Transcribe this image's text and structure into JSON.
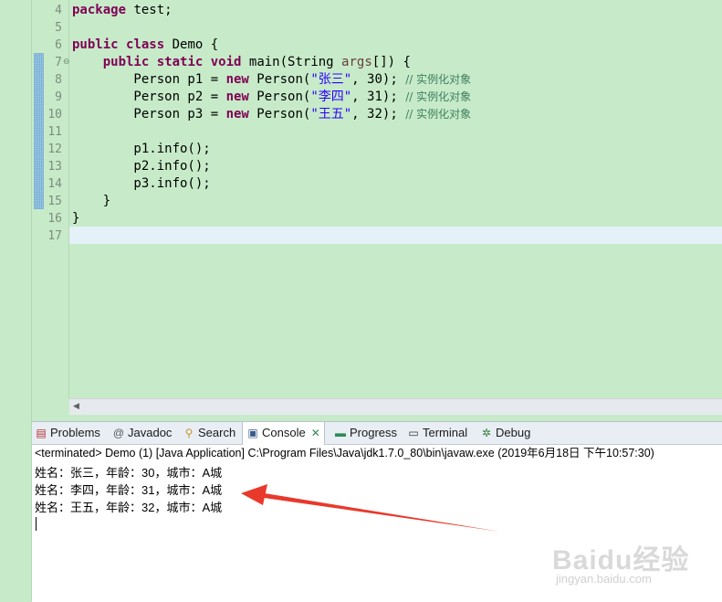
{
  "editor": {
    "line_numbers": [
      "4",
      "5",
      "6",
      "7",
      "8",
      "9",
      "10",
      "11",
      "12",
      "13",
      "14",
      "15",
      "16",
      "17"
    ],
    "fold_marker": "⊖",
    "code": {
      "l4_kw": "package",
      "l4_rest": " test;",
      "l6_kw1": "public",
      "l6_kw2": "class",
      "l6_rest": " Demo {",
      "l7_indent": "    ",
      "l7_kw1": "public",
      "l7_kw2": "static",
      "l7_kw3": "void",
      "l7_rest1": " main(String ",
      "l7_param": "args",
      "l7_rest2": "[]) {",
      "l8_pre": "        Person p1 = ",
      "l8_kw": "new",
      "l8_mid": " Person(",
      "l8_str": "\"张三\"",
      "l8_post": ", 30); ",
      "l8_cm": "// 实例化对象",
      "l9_pre": "        Person p2 = ",
      "l9_kw": "new",
      "l9_mid": " Person(",
      "l9_str": "\"李四\"",
      "l9_post": ", 31); ",
      "l9_cm": "// 实例化对象",
      "l10_pre": "        Person p3 = ",
      "l10_kw": "new",
      "l10_mid": " Person(",
      "l10_str": "\"王五\"",
      "l10_post": ", 32); ",
      "l10_cm": "// 实例化对象",
      "l12": "        p1.info();",
      "l13": "        p2.info();",
      "l14": "        p3.info();",
      "l15": "    }",
      "l16": "}"
    }
  },
  "panel": {
    "tabs": [
      {
        "label": "Problems",
        "icon": "problems-icon"
      },
      {
        "label": "Javadoc",
        "icon": "javadoc-icon"
      },
      {
        "label": "Search",
        "icon": "search-icon"
      },
      {
        "label": "Console",
        "icon": "console-icon"
      },
      {
        "label": "Progress",
        "icon": "progress-icon"
      },
      {
        "label": "Terminal",
        "icon": "terminal-icon"
      },
      {
        "label": "Debug",
        "icon": "debug-icon"
      }
    ],
    "status": "<terminated> Demo (1) [Java Application] C:\\Program Files\\Java\\jdk1.7.0_80\\bin\\javaw.exe (2019年6月18日 下午10:57:30)",
    "output": [
      "姓名：张三，年龄：30，城市：A城",
      "姓名：李四，年龄：31，城市：A城",
      "姓名：王五，年龄：32，城市：A城"
    ]
  },
  "annotation": {
    "arrow_color": "#e8392b"
  },
  "watermark": {
    "brand": "Baidu经验",
    "url": "jingyan.baidu.com"
  },
  "colors": {
    "editor_bg": "#c7ebc9",
    "keyword": "#7f0055",
    "string": "#2a00ff",
    "comment": "#3f7f5f",
    "current_line": "#e4f1f8"
  }
}
